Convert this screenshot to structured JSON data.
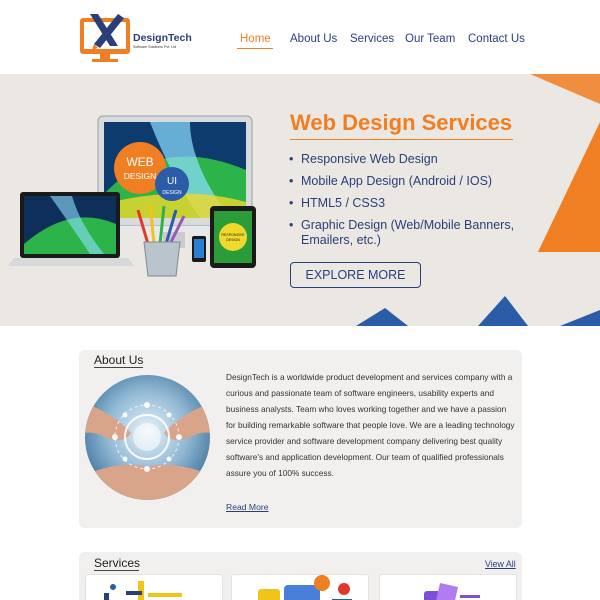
{
  "brand": {
    "name": "DesignTech",
    "tagline": "Software Solutions Pvt. Ltd",
    "colors": {
      "navy": "#2a3f7a",
      "orange": "#f07e22",
      "blue": "#2a5ca8"
    }
  },
  "nav": {
    "items": [
      {
        "label": "Home",
        "active": true
      },
      {
        "label": "About Us",
        "active": false
      },
      {
        "label": "Services",
        "active": false
      },
      {
        "label": "Our Team",
        "active": false
      },
      {
        "label": "Contact Us",
        "active": false
      }
    ]
  },
  "hero": {
    "title": "Web Design Services",
    "bullets": [
      "Responsive Web Design",
      "Mobile App Design (Android / IOS)",
      "HTML5 / CSS3",
      "Graphic Design (Web/Mobile Banners, Emailers, etc.)"
    ],
    "cta_label": "EXPLORE MORE",
    "badge_web": "WEB",
    "badge_design": "DESIGN",
    "badge_ui": "UI",
    "badge_ui_sub": "DESIGN",
    "tablet_label_1": "RESPONSIVE",
    "tablet_label_2": "DESIGN"
  },
  "about": {
    "title": "About Us",
    "body": "DesignTech is a worldwide product development and services company with a curious and passionate team of software engineers, usability experts and business analysts. Team who loves working together and we have a passion for building remarkable software that people love. We are a leading technology service provider and software development company delivering best quality software's and application development. Our team of qualified professionals assure you of 100% success.",
    "read_more": "Read More"
  },
  "services": {
    "title": "Services",
    "view_all": "View All"
  }
}
